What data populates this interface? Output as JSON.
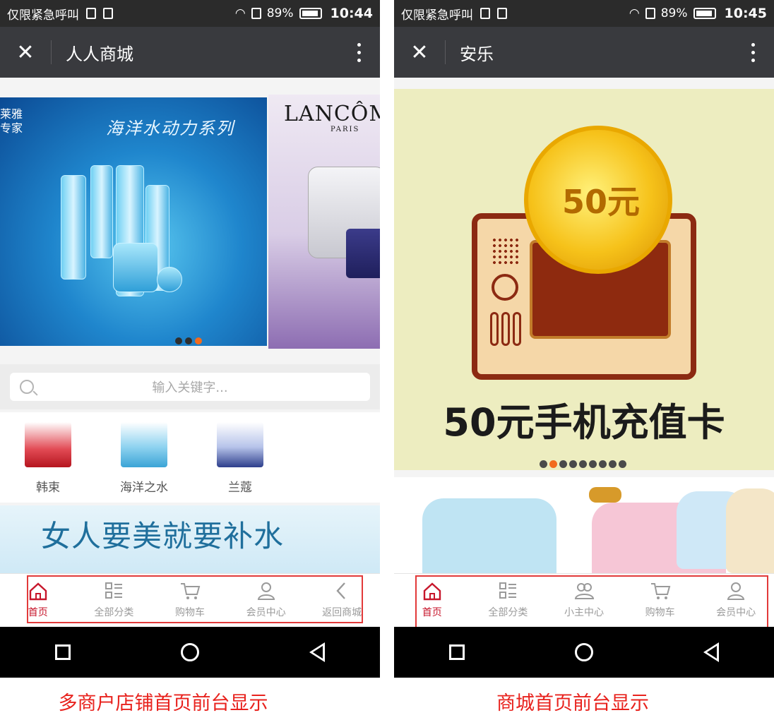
{
  "left_phone": {
    "status": {
      "carrier": "仅限紧急呼叫",
      "battery": "89%",
      "time": "10:44"
    },
    "title": "人人商城",
    "banner": {
      "slide_a_brand": "莱雅\n专家",
      "slide_a_headline": "海洋水动力系列",
      "slide_b_brand": "LANCÔM",
      "slide_b_sub": "PARIS",
      "dots": 3,
      "active_dot": 3
    },
    "search_placeholder": "输入关键字...",
    "brands": [
      {
        "label": "韩束",
        "color": "#d8242f"
      },
      {
        "label": "海洋之水",
        "color": "#4fb6e4"
      },
      {
        "label": "兰蔻",
        "color": "#3a4fa8"
      }
    ],
    "promo_text": "女人要美就要补水",
    "tabs": [
      {
        "label": "首页",
        "icon": "home-icon",
        "active": true
      },
      {
        "label": "全部分类",
        "icon": "grid-list-icon",
        "active": false
      },
      {
        "label": "购物车",
        "icon": "cart-icon",
        "active": false
      },
      {
        "label": "会员中心",
        "icon": "user-icon",
        "active": false
      },
      {
        "label": "返回商城",
        "icon": "chevron-left-icon",
        "active": false
      }
    ],
    "caption": "多商户店铺首页前台显示"
  },
  "right_phone": {
    "status": {
      "carrier": "仅限紧急呼叫",
      "battery": "89%",
      "time": "10:45"
    },
    "title": "安乐",
    "banner": {
      "coin_text": "50元",
      "card_caption": "50元手机充值卡",
      "dots": 9,
      "active_dot": 2
    },
    "tabs": [
      {
        "label": "首页",
        "icon": "home-icon",
        "active": true
      },
      {
        "label": "全部分类",
        "icon": "grid-list-icon",
        "active": false
      },
      {
        "label": "小主中心",
        "icon": "group-icon",
        "active": false
      },
      {
        "label": "购物车",
        "icon": "cart-icon",
        "active": false
      },
      {
        "label": "会员中心",
        "icon": "user-icon",
        "active": false
      }
    ],
    "caption": "商城首页前台显示"
  },
  "colors": {
    "accent_active": "#c7162b",
    "highlight_border": "#e23a3a",
    "caption_red": "#e8221d",
    "title_bar": "#393a3e",
    "dot_active": "#f26b1d"
  }
}
